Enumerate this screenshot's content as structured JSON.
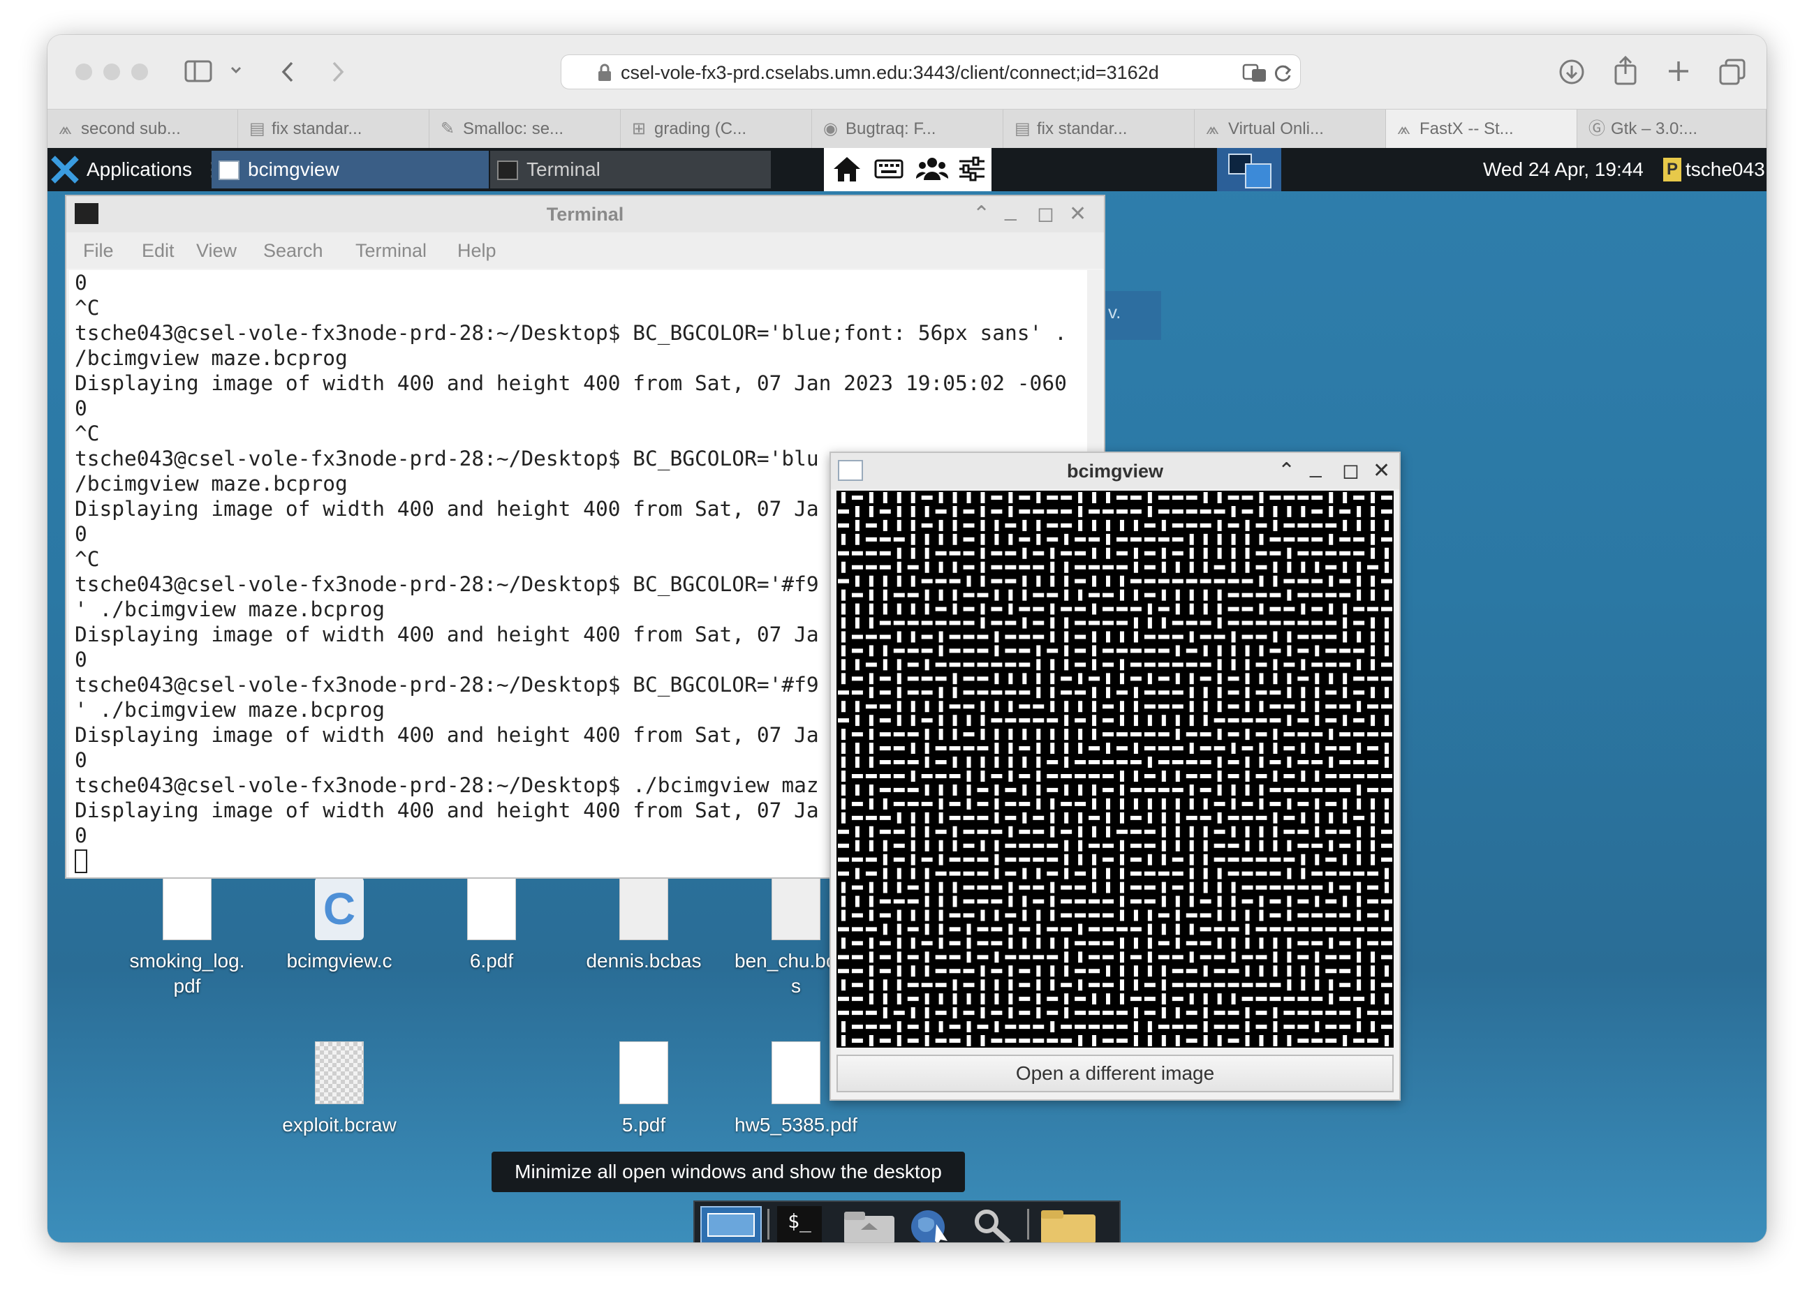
{
  "browser": {
    "url": "csel-vole-fx3-prd.cselabs.umn.edu:3443/client/connect;id=3162d",
    "tabs": [
      {
        "label": "second sub...",
        "icon": "fastx-icon",
        "active": false
      },
      {
        "label": "fix standar...",
        "icon": "document-icon",
        "active": false
      },
      {
        "label": "Smalloc: se...",
        "icon": "feather-icon",
        "active": false
      },
      {
        "label": "grading (C...",
        "icon": "plus-box-icon",
        "active": false
      },
      {
        "label": "Bugtraq: F...",
        "icon": "eye-icon",
        "active": false
      },
      {
        "label": "fix standar...",
        "icon": "document-icon",
        "active": false
      },
      {
        "label": "Virtual Onli...",
        "icon": "fastx-icon",
        "active": false
      },
      {
        "label": "FastX -- St...",
        "icon": "fastx-icon",
        "active": true
      },
      {
        "label": "Gtk – 3.0:...",
        "icon": "g-icon",
        "active": false
      }
    ]
  },
  "panel": {
    "applications_label": "Applications",
    "task_bcimgview": "bcimgview",
    "task_terminal": "Terminal",
    "clock": "Wed 24 Apr, 19:44",
    "user": "tsche043"
  },
  "terminal": {
    "title": "Terminal",
    "menu": [
      "File",
      "Edit",
      "View",
      "Search",
      "Terminal",
      "Help"
    ],
    "lines": [
      "0",
      "^C",
      "tsche043@csel-vole-fx3node-prd-28:~/Desktop$ BC_BGCOLOR='blue;font: 56px sans' .",
      "/bcimgview maze.bcprog",
      "Displaying image of width 400 and height 400 from Sat, 07 Jan 2023 19:05:02 -060",
      "0",
      "^C",
      "tsche043@csel-vole-fx3node-prd-28:~/Desktop$ BC_BGCOLOR='blu",
      "/bcimgview maze.bcprog",
      "Displaying image of width 400 and height 400 from Sat, 07 Ja",
      "0",
      "^C",
      "tsche043@csel-vole-fx3node-prd-28:~/Desktop$ BC_BGCOLOR='#f9",
      "' ./bcimgview maze.bcprog",
      "Displaying image of width 400 and height 400 from Sat, 07 Ja",
      "0",
      "tsche043@csel-vole-fx3node-prd-28:~/Desktop$ BC_BGCOLOR='#f9",
      "' ./bcimgview maze.bcprog",
      "Displaying image of width 400 and height 400 from Sat, 07 Ja",
      "0",
      "tsche043@csel-vole-fx3node-prd-28:~/Desktop$ ./bcimgview maz",
      "Displaying image of width 400 and height 400 from Sat, 07 Ja",
      "0"
    ]
  },
  "bcimgview": {
    "title": "bcimgview",
    "button": "Open a different image"
  },
  "desktop_icons": [
    {
      "label": "smoking_log.\npdf",
      "icon": "pdf-file-icon"
    },
    {
      "label": "bcimgview.c",
      "icon": "c-source-icon"
    },
    {
      "label": "6.pdf",
      "icon": "pdf-file-icon"
    },
    {
      "label": "dennis.bcbas",
      "icon": "text-file-icon"
    },
    {
      "label": "ben_chu.bcba\ns",
      "icon": "text-file-icon"
    },
    {
      "label": "exploit.bcraw",
      "icon": "image-file-icon"
    },
    {
      "label": "5.pdf",
      "icon": "pdf-file-icon"
    },
    {
      "label": "hw5_5385.pdf",
      "icon": "pdf-file-icon"
    }
  ],
  "partial_text": "v.",
  "tooltip": "Minimize all open windows and show the desktop",
  "colors": {
    "desktop_blue": "#2f7eac",
    "panel_dark": "#151a1e",
    "task_active": "#3a5e86"
  }
}
